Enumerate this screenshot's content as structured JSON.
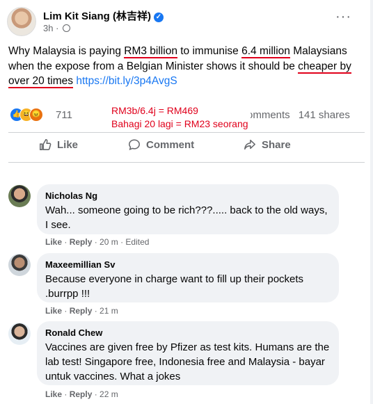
{
  "post": {
    "author": "Lim Kit Siang (林吉祥)",
    "time": "3h ·",
    "more": "···",
    "text_before": "Why Malaysia is paying ",
    "hl1": "RM3 billion",
    "text_mid1": " to immunise ",
    "hl2": "6.4 million",
    "text_mid2": " Malaysians when the expose from a Belgian Minister shows it should be ",
    "hl3": "cheaper by over 20 times",
    "text_mid3": " ",
    "link": "https://bit.ly/3p4AvgS",
    "reaction_count": "711",
    "comments_label": "omments",
    "shares_label": "141 shares",
    "annotation_line1": "RM3b/6.4j = RM469",
    "annotation_line2": "Bahagi 20 lagi = RM23 seorang"
  },
  "actions": {
    "like": "Like",
    "comment": "Comment",
    "share": "Share"
  },
  "comments": [
    {
      "name": "Nicholas Ng",
      "text": "Wah... someone going to be rich???..... back to the old ways, I see.",
      "like": "Like",
      "reply": "Reply",
      "time": "20 m",
      "edited": "Edited"
    },
    {
      "name": "Maxeemillian Sv",
      "text": "Because everyone in charge want to fill up their pockets .burrpp !!!",
      "like": "Like",
      "reply": "Reply",
      "time": "21 m",
      "edited": ""
    },
    {
      "name": "Ronald Chew",
      "text": "Vaccines are given free by Pfizer as test kits. Humans are the lab test! Singapore free, Indonesia free and Malaysia - bayar untuk vaccines. What a jokes",
      "like": "Like",
      "reply": "Reply",
      "time": "22 m",
      "edited": ""
    }
  ],
  "colors": {
    "accent": "#1877f2",
    "annotation": "#e0001b",
    "bubble": "#f0f2f5",
    "muted": "#65676b"
  },
  "icons": [
    "verified-icon",
    "globe-icon",
    "more-icon",
    "like-reaction-icon",
    "haha-reaction-icon",
    "angry-reaction-icon",
    "thumbs-up-icon",
    "comment-icon",
    "share-icon"
  ]
}
